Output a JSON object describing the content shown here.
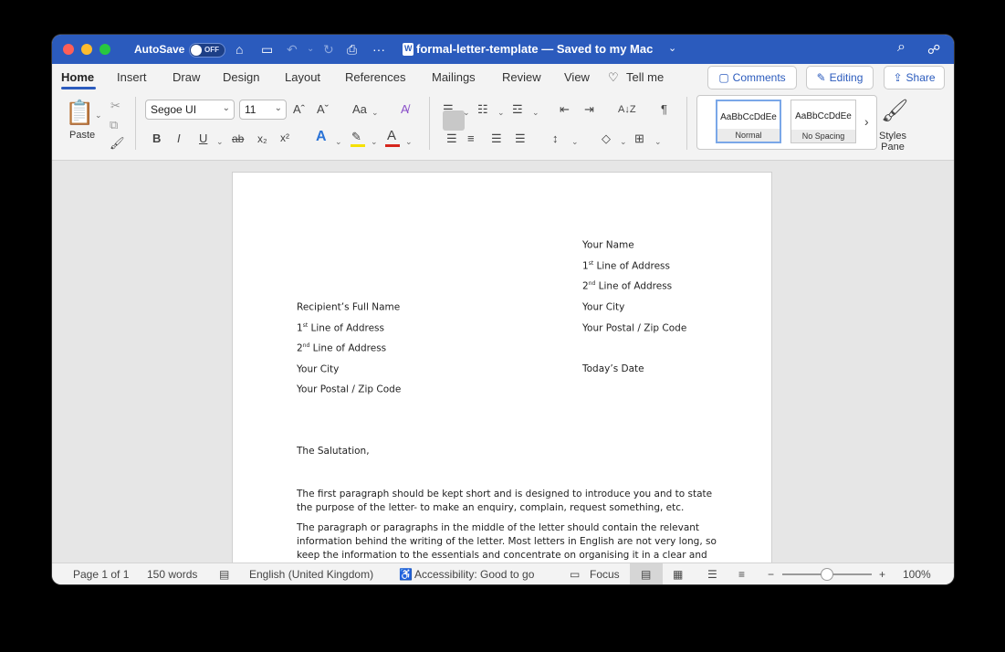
{
  "titlebar": {
    "autosave_label": "AutoSave",
    "toggle_state": "OFF",
    "doc_title": "formal-letter-template — Saved to my Mac",
    "title_chevron": "⌄",
    "icons": {
      "home": "⌂",
      "save": "▭",
      "undo": "↶",
      "undo_menu": "⌄",
      "redo": "↻",
      "print": "⎙",
      "more": "···",
      "search": "⌕",
      "collab": "☍"
    }
  },
  "ribbon_tabs": [
    "Home",
    "Insert",
    "Draw",
    "Design",
    "Layout",
    "References",
    "Mailings",
    "Review",
    "View",
    "Tell me"
  ],
  "tell_me_icon": "♡",
  "ribbon_buttons": {
    "comments": "Comments",
    "editing": "Editing",
    "share": "Share",
    "comments_icon": "▢",
    "editing_icon": "✎",
    "share_icon": "⇪"
  },
  "clipboard": {
    "paste_label": "Paste",
    "paste_icon": "📋",
    "cut_icon": "✂",
    "copy_icon": "⧉",
    "format_painter_icon": "🖌"
  },
  "font": {
    "name": "Segoe UI",
    "size": "11",
    "grow": "Aˆ",
    "shrink": "Aˇ",
    "change_case": "Aa",
    "clear_format": "A̸",
    "bold": "B",
    "italic": "I",
    "underline": "U",
    "strike": "ab",
    "subscript": "x₂",
    "superscript": "x²",
    "text_effects": "A",
    "highlight": "✎",
    "font_color": "A",
    "chev": "⌄",
    "highlight_color": "#f5e100",
    "font_color_bar": "#d6261d",
    "text_effects_color": "#2b73d6"
  },
  "paragraph": {
    "bullets": "☰",
    "numbering": "☷",
    "multilevel": "☲",
    "decrease_indent": "⇤",
    "increase_indent": "⇥",
    "sort": "A↓Z",
    "pilcrow": "¶",
    "align_left": "☰",
    "align_center": "≡",
    "align_right": "☰",
    "justify": "☰",
    "line_spacing": "↕",
    "shading": "◇",
    "borders": "⊞"
  },
  "styles": {
    "cards": [
      {
        "sample": "AaBbCcDdEe",
        "name": "Normal"
      },
      {
        "sample": "AaBbCcDdEe",
        "name": "No Spacing"
      }
    ],
    "more": "›",
    "pane_label_1": "Styles",
    "pane_label_2": "Pane",
    "pane_icon": "🖌"
  },
  "document": {
    "sender": [
      {
        "text": "Your Name",
        "sup": "",
        "rest": ""
      },
      {
        "text": "1",
        "sup": "st",
        "rest": " Line of Address"
      },
      {
        "text": "2",
        "sup": "nd",
        "rest": " Line of Address"
      },
      {
        "text": "Your City",
        "sup": "",
        "rest": ""
      },
      {
        "text": "Your Postal / Zip Code",
        "sup": "",
        "rest": ""
      }
    ],
    "date": "Today’s Date",
    "recipient": [
      {
        "text": "Recipient’s Full Name",
        "sup": "",
        "rest": ""
      },
      {
        "text": "1",
        "sup": "st",
        "rest": " Line of Address"
      },
      {
        "text": "2",
        "sup": "nd",
        "rest": " Line of Address"
      },
      {
        "text": "Your City",
        "sup": "",
        "rest": ""
      },
      {
        "text": "Your Postal / Zip Code",
        "sup": "",
        "rest": ""
      }
    ],
    "salutation": "The Salutation,",
    "paragraph1": "The first paragraph should be kept short and is designed to introduce you and to state the purpose of the letter- to make an enquiry, complain, request something, etc.",
    "paragraph2": "The paragraph or paragraphs in the middle of the letter should contain the relevant information behind the writing of the letter. Most letters in English are not very long, so keep the information to the essentials and concentrate on organising it in a clear and logical"
  },
  "status": {
    "page": "Page 1 of 1",
    "words": "150 words",
    "proof_icon": "▤",
    "language": "English (United Kingdom)",
    "accessibility_icon": "♿",
    "accessibility": "Accessibility: Good to go",
    "focus_icon": "▭",
    "focus": "Focus",
    "view_print": "▤",
    "view_web": "▦",
    "view_outline": "☰",
    "view_draft": "≡",
    "zoom_minus": "−",
    "zoom_plus": "+",
    "zoom": "100%",
    "zoom_fraction": 0.5
  }
}
